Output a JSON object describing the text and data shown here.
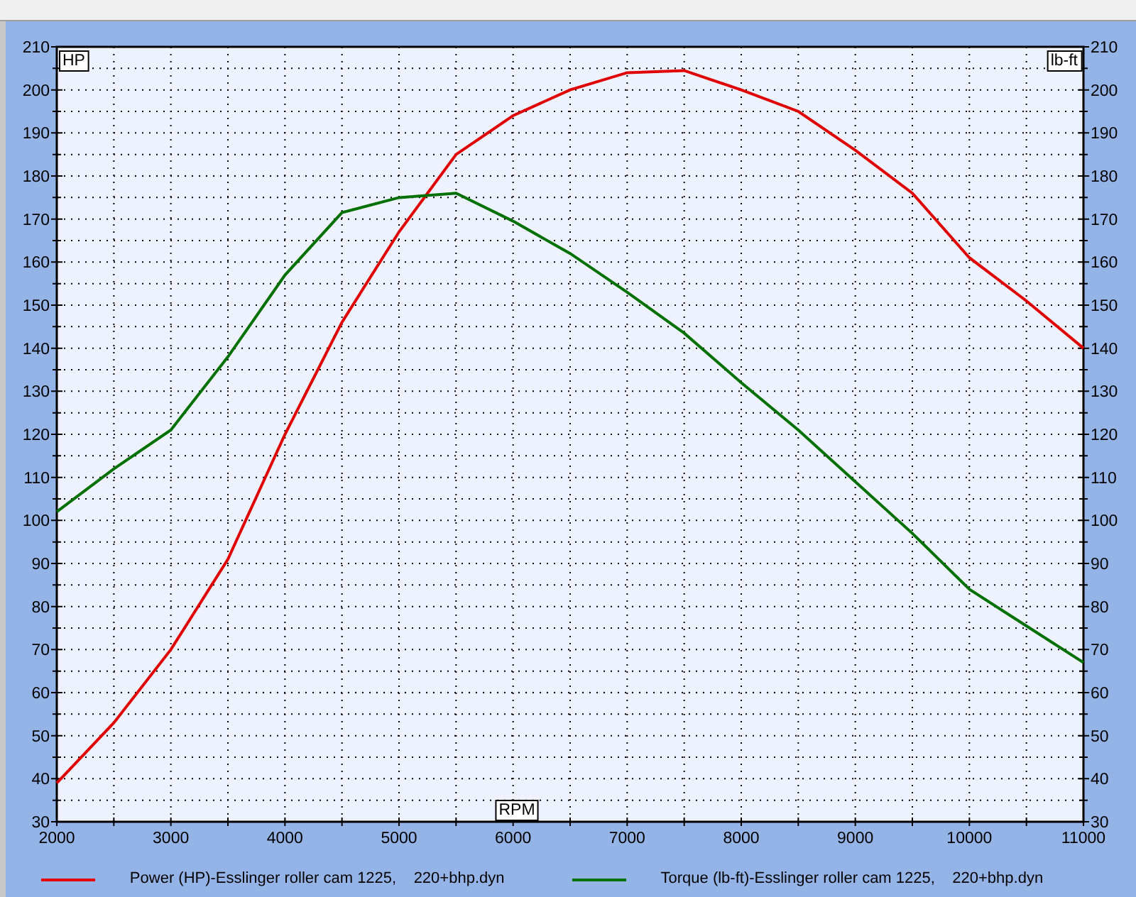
{
  "chart_data": {
    "type": "line",
    "xlabel": "RPM",
    "ylabel": "HP",
    "y2label": "lb-ft",
    "x": [
      2000,
      2500,
      3000,
      3500,
      4000,
      4500,
      5000,
      5500,
      6000,
      6500,
      7000,
      7500,
      8000,
      8500,
      9000,
      9500,
      10000,
      10500,
      11000
    ],
    "series": [
      {
        "name": "Power (HP)-Esslinger roller cam 1225,    220+bhp.dyn",
        "color": "#e00000",
        "values": [
          39,
          53,
          70,
          91,
          120,
          146,
          167,
          185,
          194,
          200,
          204,
          204.5,
          200,
          195,
          186,
          176,
          161,
          151,
          140
        ]
      },
      {
        "name": "Torque (lb-ft)-Esslinger roller cam 1225,    220+bhp.dyn",
        "color": "#007000",
        "values": [
          102,
          112,
          121,
          138,
          157,
          171.5,
          175,
          176,
          169.5,
          162,
          153,
          143.5,
          132,
          121,
          109,
          97,
          84,
          75.5,
          67
        ]
      }
    ],
    "xlim": [
      2000,
      11000
    ],
    "ylim": [
      30,
      210
    ],
    "xticks": [
      2000,
      3000,
      4000,
      5000,
      6000,
      7000,
      8000,
      9000,
      10000,
      11000
    ],
    "yticks": [
      30,
      40,
      50,
      60,
      70,
      80,
      90,
      100,
      110,
      120,
      130,
      140,
      150,
      160,
      170,
      180,
      190,
      200,
      210
    ],
    "y2ticks": [
      30,
      40,
      50,
      60,
      70,
      80,
      90,
      100,
      110,
      120,
      130,
      140,
      150,
      160,
      170,
      180,
      190,
      200,
      210
    ],
    "y2lim": [
      30,
      210
    ],
    "grid": true
  }
}
